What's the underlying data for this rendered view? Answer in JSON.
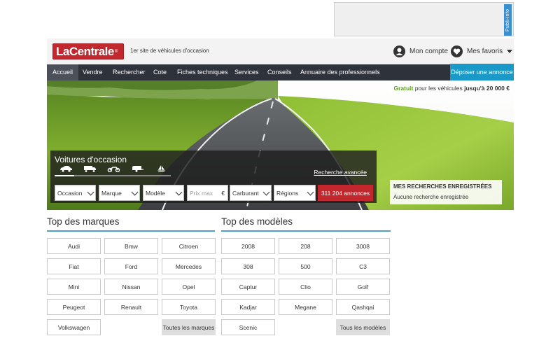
{
  "ad": {
    "tag": "Publi-info"
  },
  "header": {
    "logo": "LaCentrale",
    "logo_mark": "®",
    "tagline": "1er site de véhicules d'occasion",
    "account_label": "Mon compte",
    "favorites_label": "Mes favoris"
  },
  "nav": {
    "items": [
      {
        "label": "Accueil",
        "active": true
      },
      {
        "label": "Vendre"
      },
      {
        "label": "Rechercher"
      },
      {
        "label": "Cote"
      },
      {
        "label": "Fiches techniques"
      },
      {
        "label": "Services"
      },
      {
        "label": "Conseils"
      },
      {
        "label": "Annuaire des professionnels"
      }
    ],
    "cta": "Déposer une annonce"
  },
  "promo": {
    "green": "Gratuit",
    "middle": " pour les véhicules ",
    "bold": "jusqu'à 20 000 €"
  },
  "search": {
    "title": "Voitures d'occasion",
    "vehicle_icons": [
      "car-icon",
      "truck-icon",
      "motorbike-icon",
      "caravan-icon",
      "boat-icon"
    ],
    "advanced_link": "Recherche avancée",
    "fields": {
      "condition": "Occasion",
      "brand": "Marque",
      "model": "Modèle",
      "price_placeholder": "Prix max",
      "currency": "€",
      "fuel": "Carburant",
      "region": "Régions"
    },
    "submit": "311 204 annonces"
  },
  "saved_searches": {
    "title": "MES RECHERCHES ENREGISTRÉES",
    "empty": "Aucune recherche enregistrée"
  },
  "top_brands": {
    "title": "Top des marques",
    "items": [
      "Audi",
      "Bmw",
      "Citroen",
      "Fiat",
      "Ford",
      "Mercedes",
      "Mini",
      "Nissan",
      "Opel",
      "Peugeot",
      "Renault",
      "Toyota",
      "Volkswagen"
    ],
    "all": "Toutes les marques"
  },
  "top_models": {
    "title": "Top des modèles",
    "items": [
      "2008",
      "208",
      "3008",
      "308",
      "500",
      "C3",
      "Captur",
      "Clio",
      "Golf",
      "Kadjar",
      "Megane",
      "Qashqai",
      "Scenic"
    ],
    "all": "Tous les modèles"
  },
  "colors": {
    "brand_red": "#c1272d",
    "nav_bg": "#2e323a",
    "accent_blue": "#1a98c8",
    "rule_blue": "#4fa0c8"
  }
}
